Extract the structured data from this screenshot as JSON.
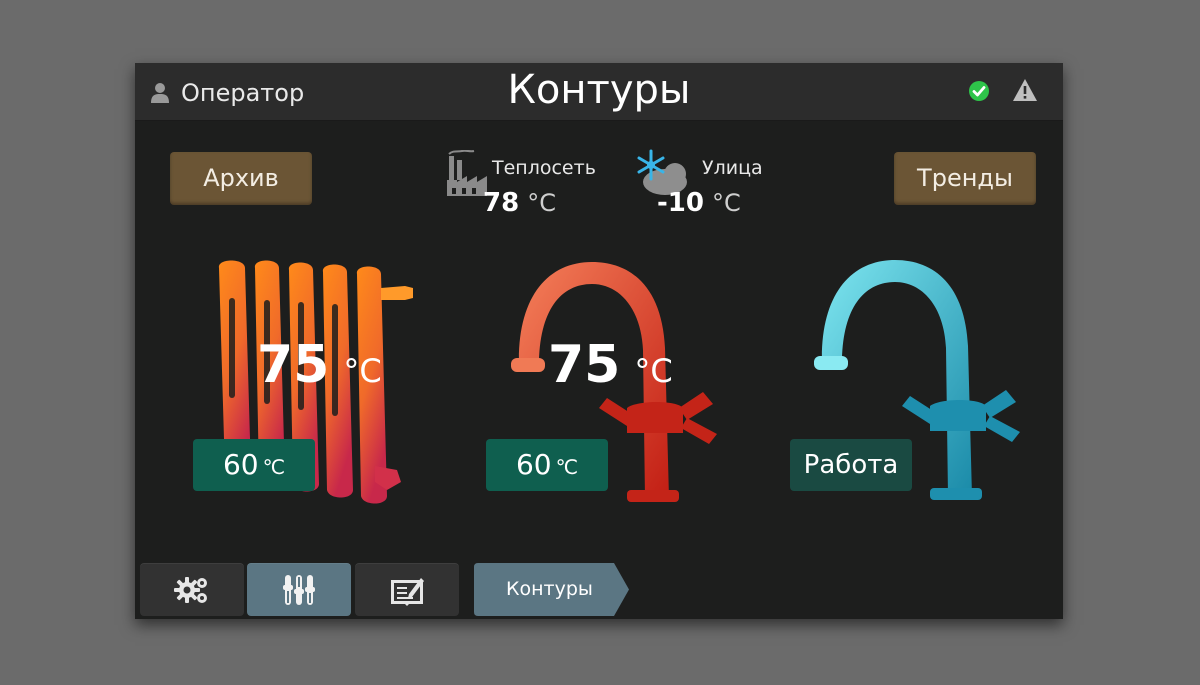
{
  "header": {
    "user_label": "Оператор",
    "title": "Контуры",
    "user_icon": "user-icon",
    "status_ok_icon": "check-circle-icon",
    "warning_icon": "warning-triangle-icon"
  },
  "buttons": {
    "archive": "Архив",
    "trends": "Тренды"
  },
  "weather": {
    "heating_network": {
      "label": "Теплосеть",
      "value": "78",
      "unit": "°C",
      "icon": "factory-icon"
    },
    "outside": {
      "label": "Улица",
      "value": "-10",
      "unit": "°C",
      "icon": "snow-cloud-icon"
    }
  },
  "circuits": [
    {
      "name": "radiator",
      "temp": "75",
      "unit": "°C",
      "setpoint_value": "60",
      "setpoint_unit": "℃",
      "color": "#ff7a1a"
    },
    {
      "name": "hot-water-tap",
      "temp": "75",
      "unit": "°C",
      "setpoint_value": "60",
      "setpoint_unit": "℃",
      "color": "#e0402a"
    },
    {
      "name": "cold-water-tap",
      "status": "Работа",
      "color": "#3fc2d6"
    }
  ],
  "bottom_nav": {
    "items": [
      {
        "icon": "gears-icon",
        "active": false
      },
      {
        "icon": "sliders-icon",
        "active": true
      },
      {
        "icon": "journal-icon",
        "active": false
      }
    ],
    "breadcrumb": "Контуры"
  },
  "colors": {
    "panel_bg": "#1d1e1d",
    "topbar_bg": "#2c2c2c",
    "brown_button": "#6b5535",
    "green_button": "#0f5f4f",
    "active_nav": "#5b7683",
    "ok_green": "#2ec44a"
  }
}
